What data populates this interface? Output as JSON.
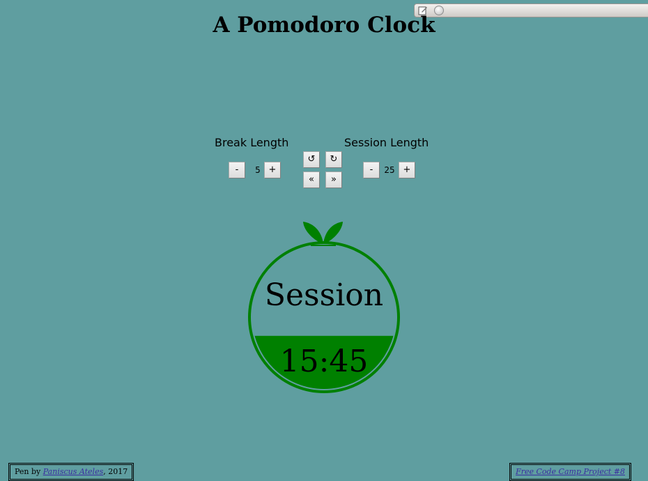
{
  "title": "A Pomodoro Clock",
  "break": {
    "label": "Break Length",
    "value": "5",
    "minus": "-",
    "plus": "+"
  },
  "session": {
    "label": "Session Length",
    "value": "25",
    "minus": "-",
    "plus": "+"
  },
  "controls": {
    "undo": "↺",
    "redo": "↻",
    "rewind": "«",
    "forward": "»"
  },
  "clock": {
    "mode": "Session",
    "time": "15:45",
    "fill_fraction": 0.37,
    "color": "#008000"
  },
  "footer": {
    "left_prefix": "Pen by ",
    "left_author": "Paniscus Ateles",
    "left_suffix": ", 2017",
    "right_link": "Free Code Camp Project #8"
  },
  "colors": {
    "background": "#5f9ea0",
    "accent": "#008000"
  }
}
